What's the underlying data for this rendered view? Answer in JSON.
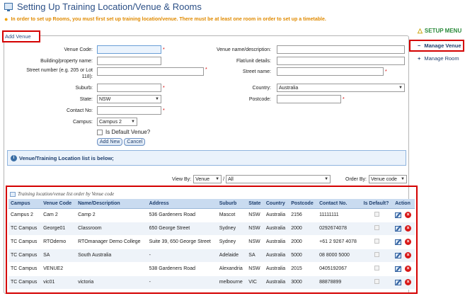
{
  "page": {
    "title": "Setting Up Training Location/Venue & Rooms",
    "warning": "In order to set up Rooms, you must first set up training location/venue. There must be at least one room in order to set up a timetable."
  },
  "form": {
    "legend": "Add Venue",
    "labels": {
      "venue_code": "Venue Code:",
      "building": "Building/property name:",
      "street_number_1": "Street number (e.g. 205 or Lot",
      "street_number_2": "118):",
      "suburb": "Suburb:",
      "state": "State:",
      "contact_no": "Contact No:",
      "campus": "Campus:",
      "venue_name": "Venue name/description:",
      "flat_unit": "Flat/unit details:",
      "street_name": "Street name:",
      "country": "Country:",
      "postcode": "Postcode:"
    },
    "values": {
      "venue_code": "",
      "building": "",
      "street_number": "",
      "suburb": "",
      "state": "NSW",
      "contact_no": "",
      "campus": "Campus 2",
      "venue_name": "",
      "flat_unit": "",
      "street_name": "",
      "country": "Australia",
      "postcode": ""
    },
    "required_mark": "*",
    "default_venue_label": "Is Default Venue?",
    "add_new_label": "Add New",
    "cancel_label": "Cancel"
  },
  "info_text": "Venue/Training Location list is below;",
  "filters": {
    "view_by_label": "View By:",
    "view_by_value": "Venue",
    "separator": "/",
    "scope_value": "All",
    "order_by_label": "Order By:",
    "order_by_value": "Venue code"
  },
  "grid": {
    "caption": "Training location/venue list order by Venue code",
    "columns": [
      "Campus",
      "Venue Code",
      "Name/Description",
      "Address",
      "Suburb",
      "State",
      "Country",
      "Postcode",
      "Contact No.",
      "Is Default?",
      "Action"
    ],
    "rows": [
      [
        "Campus 2",
        "Cam 2",
        "Camp 2",
        "536 Gardeners Road",
        "Mascot",
        "NSW",
        "Australia",
        "2156",
        "11111111"
      ],
      [
        "TC Campus",
        "George01",
        "Classroom",
        "650 George Street",
        "Sydney",
        "NSW",
        "Australia",
        "2000",
        "0292674078"
      ],
      [
        "TC Campus",
        "RTOdemo",
        "RTOmanager Demo College",
        "Suite 39, 650 George Street",
        "Sydney",
        "NSW",
        "Australia",
        "2000",
        "+61 2 9267 4078"
      ],
      [
        "TC Campus",
        "SA",
        "South Australia",
        "-",
        "Adelaide",
        "SA",
        "Australia",
        "5000",
        "08 8000 5000"
      ],
      [
        "TC Campus",
        "VENUE2",
        "",
        "538 Gardeners Road",
        "Alexandria",
        "NSW",
        "Australia",
        "2015",
        "0405192067"
      ],
      [
        "TC Campus",
        "vic01",
        "victoria",
        "-",
        "melbourne",
        "VIC",
        "Australia",
        "3000",
        "88878899"
      ]
    ]
  },
  "sidebar": {
    "title": "SETUP MENU",
    "items": [
      {
        "label": "Manage Venue",
        "symbol": "−"
      },
      {
        "label": "Manage Room",
        "symbol": "+"
      }
    ]
  },
  "colors": {
    "accent_blue": "#2b4f86",
    "warning_orange": "#e08a00",
    "highlight_red": "#d40000",
    "menu_green": "#2a8a3a",
    "grid_header": "#c9dbf0"
  },
  "icons": [
    "computer-icon",
    "lightbulb-icon",
    "info-icon",
    "table-icon",
    "edit-icon",
    "delete-icon",
    "up-arrow-icon",
    "chevron-down-icon"
  ]
}
